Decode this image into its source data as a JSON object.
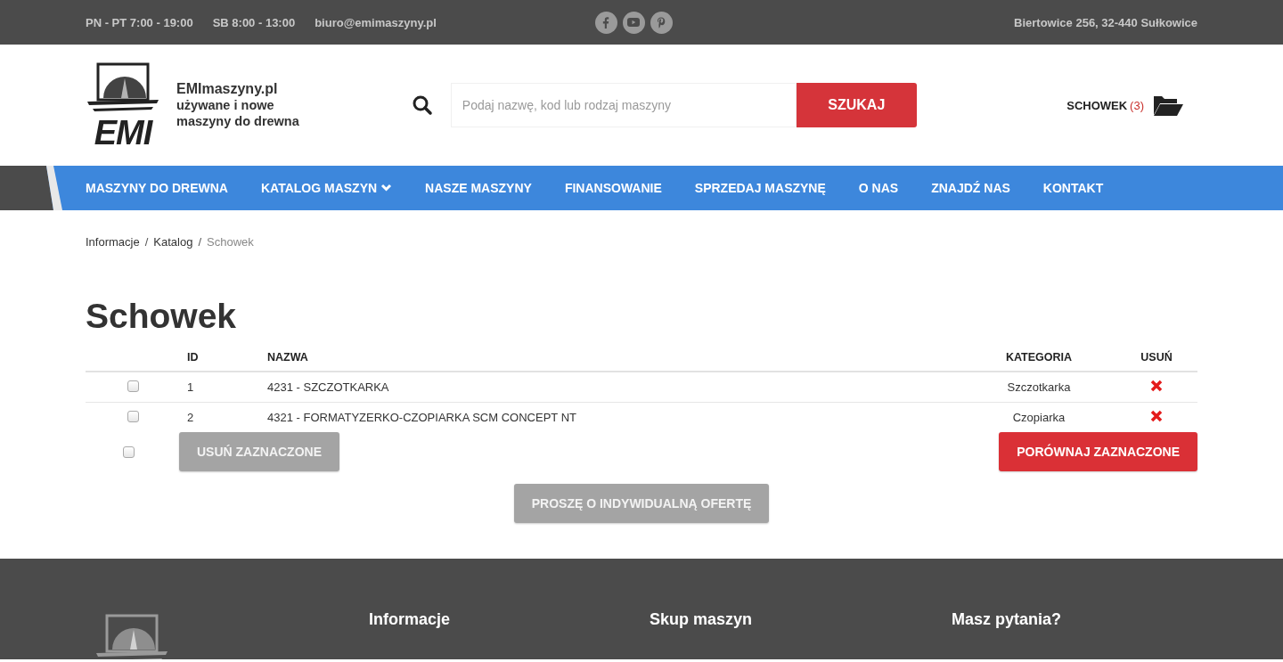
{
  "top_bar": {
    "hours": [
      "PN - PT 7:00 - 19:00",
      "SB 8:00 - 13:00"
    ],
    "email": "biuro@emimaszyny.pl",
    "address": "Biertowice 256, 32-440 Sułkowice"
  },
  "header": {
    "logo_text": "EMI",
    "tagline": [
      "EMImaszyny.pl",
      "używane i nowe",
      "maszyny do drewna"
    ],
    "search": {
      "placeholder": "Podaj nazwę, kod lub rodzaj maszyny",
      "button": "SZUKAJ"
    },
    "clipboard": {
      "label": "SCHOWEK",
      "count": "(3)"
    }
  },
  "nav": [
    {
      "label": "MASZYNY DO DREWNA",
      "has_dropdown": false
    },
    {
      "label": "KATALOG MASZYN",
      "has_dropdown": true
    },
    {
      "label": "NASZE MASZYNY",
      "has_dropdown": false
    },
    {
      "label": "FINANSOWANIE",
      "has_dropdown": false
    },
    {
      "label": "SPRZEDAJ MASZYNĘ",
      "has_dropdown": false
    },
    {
      "label": "O NAS",
      "has_dropdown": false
    },
    {
      "label": "ZNAJDŹ NAS",
      "has_dropdown": false
    },
    {
      "label": "KONTAKT",
      "has_dropdown": false
    }
  ],
  "breadcrumb": [
    {
      "label": "Informacje",
      "current": false
    },
    {
      "separator": "/",
      "label": "Katalog",
      "current": false
    },
    {
      "separator": "/",
      "label": "Schowek",
      "current": true
    }
  ],
  "page_title": "Schowek",
  "table": {
    "columns": [
      "ID",
      "NAZWA",
      "KATEGORIA",
      "USUŃ"
    ],
    "rows": [
      {
        "checked": false,
        "id": "1",
        "name": "4231 - SZCZOTKARKA",
        "category": "Szczotkarka"
      },
      {
        "checked": false,
        "id": "2",
        "name": "4321 - FORMATYZERKO-CZOPIARKA SCM CONCEPT NT",
        "category": "Czopiarka"
      }
    ]
  },
  "select_all": {
    "checked": false
  },
  "buttons": {
    "delete_selected": "USUŃ ZAZNACZONE",
    "compare_selected": "PORÓWNAJ ZAZNACZONE",
    "request_offer": "PROSZĘ O INDYWIDUALNĄ OFERTĘ"
  },
  "footer": {
    "headings": [
      "Informacje",
      "Skup maszyn",
      "Masz pytania?"
    ]
  }
}
